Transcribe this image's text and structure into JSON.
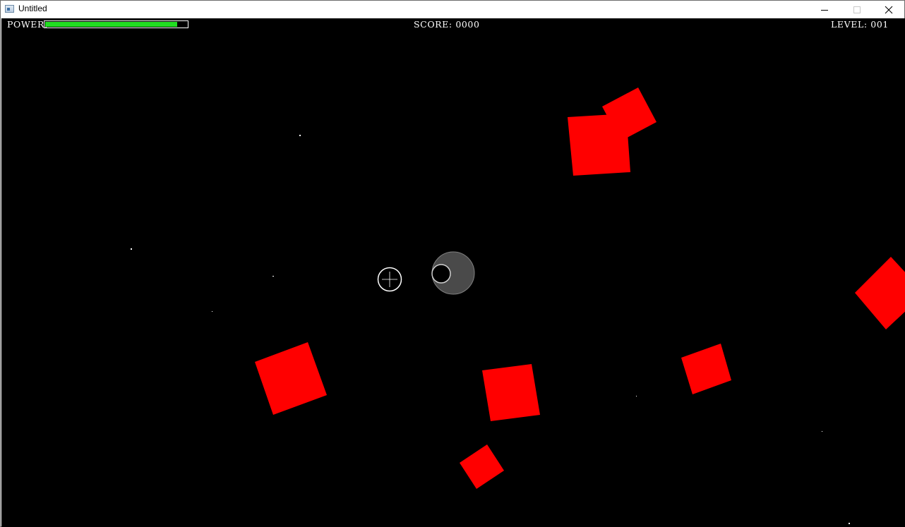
{
  "window": {
    "title": "Untitled"
  },
  "hud": {
    "power_label": "POWER:",
    "power_level": 0.93,
    "power_color": "#22dd22",
    "score_label": "SCORE:",
    "score_value": "0000",
    "level_label": "LEVEL:",
    "level_value": "001"
  },
  "colors": {
    "background": "#000000",
    "asteroid": "#ff0000",
    "player": "#4a4a4a",
    "reticle": "#ffffff",
    "star": "#ffffff"
  },
  "entities": {
    "player": "gray-ship",
    "crosshair": "aim-reticle",
    "asteroid_shape": "red-square"
  }
}
